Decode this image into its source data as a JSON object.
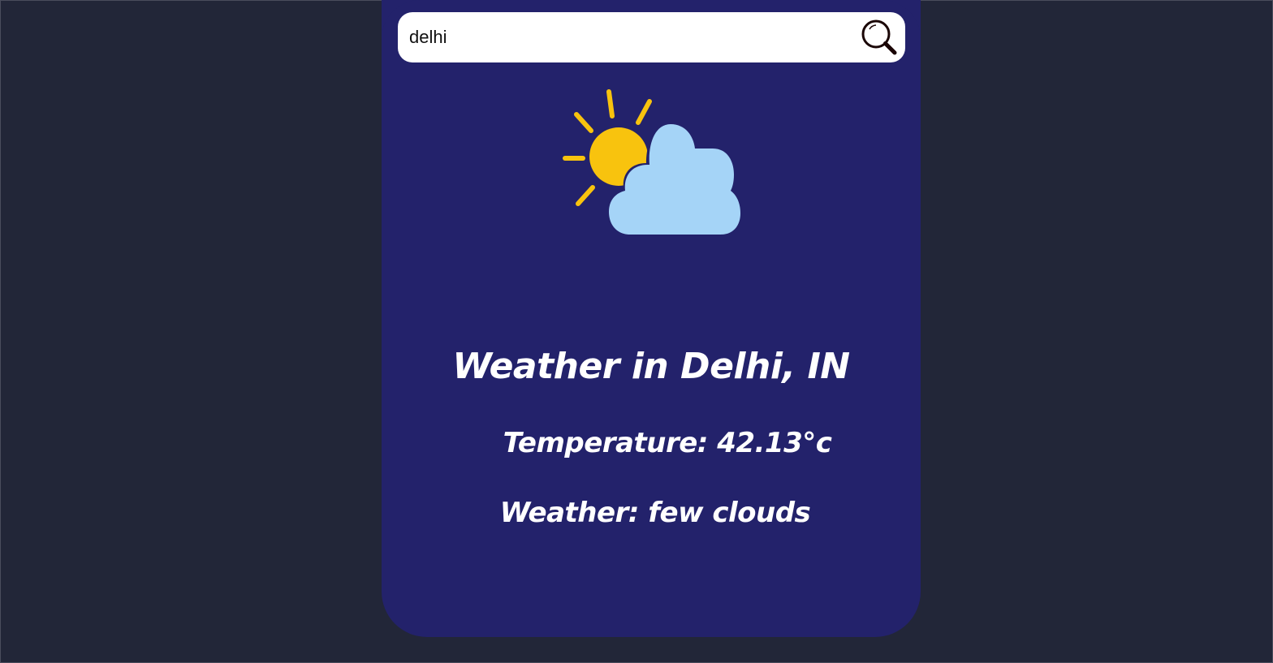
{
  "search": {
    "value": "delhi"
  },
  "weather": {
    "icon": "partly-cloudy-icon",
    "title": "Weather in Delhi, IN",
    "temperature": "Temperature: 42.13°c",
    "condition": "Weather: few clouds"
  },
  "colors": {
    "background": "#222638",
    "card": "#23226b",
    "sun": "#f8c30e",
    "cloud": "#a5d4f7",
    "text": "#ffffff"
  }
}
